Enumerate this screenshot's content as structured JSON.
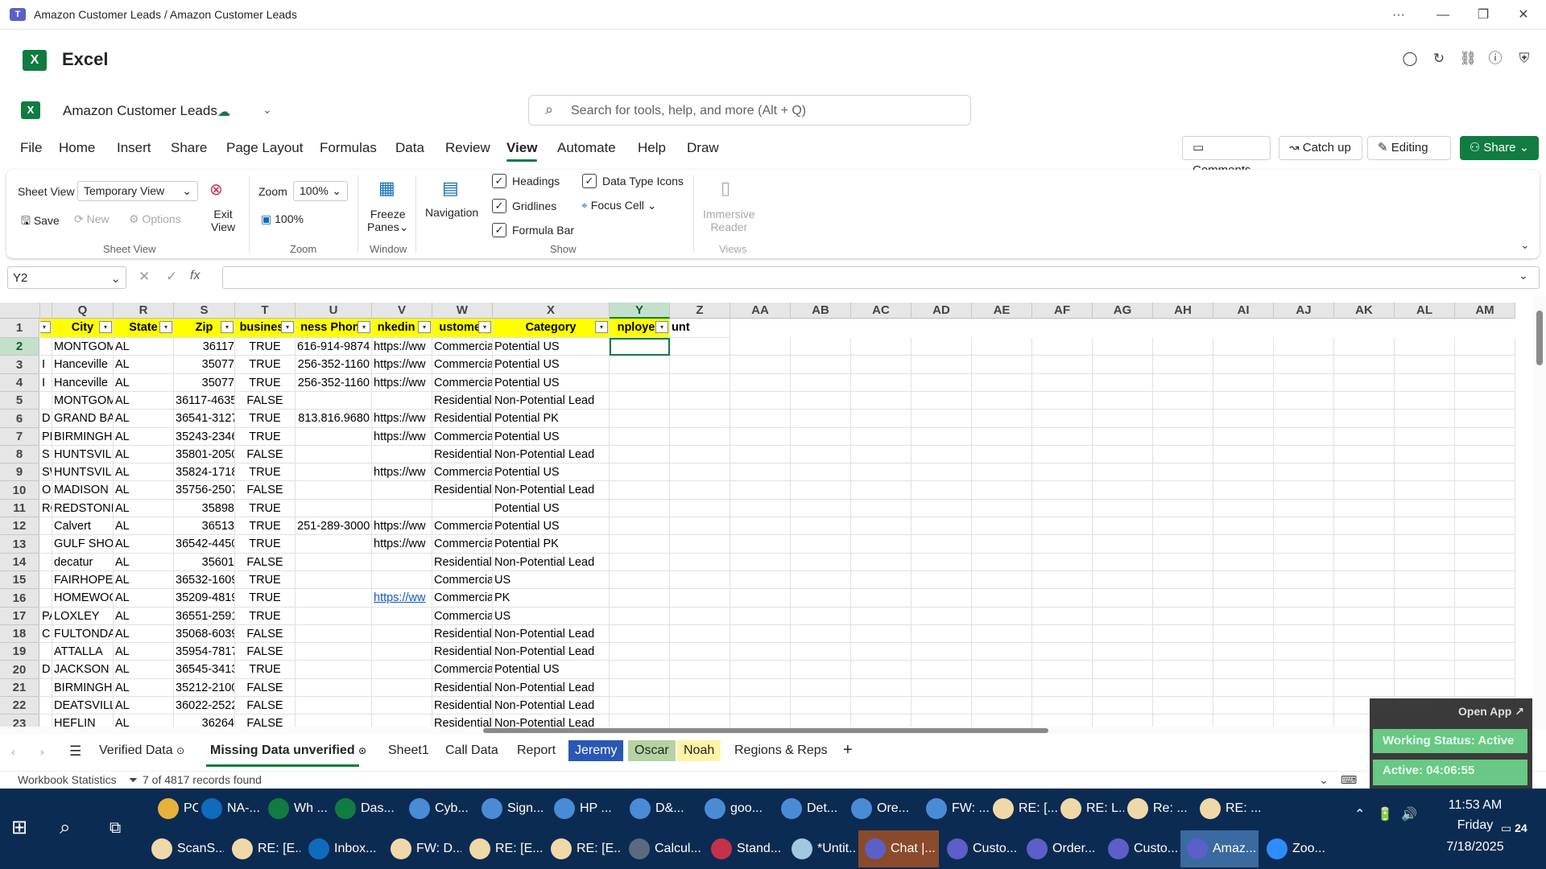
{
  "window": {
    "title": "Amazon Customer Leads / Amazon Customer Leads",
    "more": "···",
    "minimize": "—",
    "restore": "❐",
    "close": "✕"
  },
  "app": {
    "name": "Excel",
    "logo": "X"
  },
  "document": {
    "name": "Amazon Customer Leads",
    "save_status": "saved-cloud-icon"
  },
  "search": {
    "placeholder": "Search for tools, help, and more (Alt + Q)"
  },
  "menu": {
    "items": [
      "File",
      "Home",
      "Insert",
      "Share",
      "Page Layout",
      "Formulas",
      "Data",
      "Review",
      "View",
      "Automate",
      "Help",
      "Draw"
    ],
    "active": "View"
  },
  "buttons": {
    "comments": "Comments",
    "catch_up": "Catch up",
    "editing": "Editing",
    "share": "Share"
  },
  "ribbon": {
    "sheet_view": {
      "label": "Sheet View",
      "value": "Temporary View",
      "save": "Save",
      "new": "New",
      "options": "Options",
      "exit": "Exit",
      "exit2": "View",
      "group": "Sheet View"
    },
    "zoom": {
      "label": "Zoom",
      "value": "100%",
      "reset": "100%",
      "group": "Zoom"
    },
    "window": {
      "freeze": "Freeze",
      "panes": "Panes",
      "group": "Window"
    },
    "navigation": {
      "label": "Navigation"
    },
    "show": {
      "headings": "Headings",
      "gridlines": "Gridlines",
      "formula_bar": "Formula Bar",
      "data_type_icons": "Data Type Icons",
      "focus_cell": "Focus Cell",
      "group": "Show"
    },
    "views": {
      "immersive": "Immersive",
      "reader": "Reader",
      "group": "Views"
    }
  },
  "formula_bar": {
    "name_box": "Y2",
    "fx": "fx",
    "value": ""
  },
  "grid": {
    "columns": [
      "Q",
      "R",
      "S",
      "T",
      "U",
      "V",
      "W",
      "X",
      "Y",
      "Z",
      "AA",
      "AB",
      "AC",
      "AD",
      "AE",
      "AF",
      "AG",
      "AH",
      "AI",
      "AJ",
      "AK",
      "AL",
      "AM"
    ],
    "selected_column": "Y",
    "selected_row": "2",
    "header_row": [
      "City",
      "State",
      "Zip",
      "business",
      "ness Phone",
      "nkedin P",
      "ustomer",
      "Category",
      "nployee",
      "unt"
    ],
    "rows": [
      {
        "n": "2",
        "p": "",
        "q": "MONTGOM",
        "r": "AL",
        "s": "36117",
        "t": "TRUE",
        "u": "616-914-9874",
        "v": "https://ww",
        "w": "Commercia",
        "x": "Potential US"
      },
      {
        "n": "3",
        "p": "I",
        "q": "Hanceville",
        "r": "AL",
        "s": "35077",
        "t": "TRUE",
        "u": "256-352-1160",
        "v": "https://ww",
        "w": "Commercia",
        "x": "Potential US"
      },
      {
        "n": "4",
        "p": "I",
        "q": "Hanceville",
        "r": "AL",
        "s": "35077",
        "t": "TRUE",
        "u": "256-352-1160",
        "v": "https://ww",
        "w": "Commercia",
        "x": "Potential US"
      },
      {
        "n": "5",
        "p": "",
        "q": "MONTGOM",
        "r": "AL",
        "s": "36117-4635",
        "t": "FALSE",
        "u": "",
        "v": "",
        "w": "Residential",
        "x": "Non-Potential Lead"
      },
      {
        "n": "6",
        "p": "D",
        "q": "GRAND BA",
        "r": "AL",
        "s": "36541-3127",
        "t": "TRUE",
        "u": "813.816.9680",
        "v": "https://ww",
        "w": "Residential",
        "x": "Potential PK"
      },
      {
        "n": "7",
        "p": "PK",
        "q": "BIRMINGH",
        "r": "AL",
        "s": "35243-2346",
        "t": "TRUE",
        "u": "",
        "v": "https://ww",
        "w": "Commercia",
        "x": "Potential US"
      },
      {
        "n": "8",
        "p": "S",
        "q": "HUNTSVILL",
        "r": "AL",
        "s": "35801-2050",
        "t": "FALSE",
        "u": "",
        "v": "",
        "w": "Residential",
        "x": "Non-Potential Lead"
      },
      {
        "n": "9",
        "p": "SW",
        "q": "HUNTSVILL",
        "r": "AL",
        "s": "35824-1718",
        "t": "TRUE",
        "u": "",
        "v": "https://ww",
        "w": "Commercia",
        "x": "Potential US"
      },
      {
        "n": "10",
        "p": "OR",
        "q": "MADISON",
        "r": "AL",
        "s": "35756-2507",
        "t": "FALSE",
        "u": "",
        "v": "",
        "w": "Residential",
        "x": "Non-Potential Lead"
      },
      {
        "n": "11",
        "p": "RO",
        "q": "REDSTONI",
        "r": "AL",
        "s": "35898",
        "t": "TRUE",
        "u": "",
        "v": "",
        "w": "",
        "x": "Potential US"
      },
      {
        "n": "12",
        "p": "",
        "q": "Calvert",
        "r": "AL",
        "s": "36513",
        "t": "TRUE",
        "u": "251-289-3000",
        "v": "https://ww",
        "w": "Commercia",
        "x": "Potential US"
      },
      {
        "n": "13",
        "p": "",
        "q": "GULF SHO",
        "r": "AL",
        "s": "36542-4450",
        "t": "TRUE",
        "u": "",
        "v": "https://ww",
        "w": "Commercia",
        "x": "Potential PK"
      },
      {
        "n": "14",
        "p": "",
        "q": "decatur",
        "r": "AL",
        "s": "35601",
        "t": "FALSE",
        "u": "",
        "v": "",
        "w": "Residential",
        "x": "Non-Potential Lead"
      },
      {
        "n": "15",
        "p": "",
        "q": "FAIRHOPE",
        "r": "AL",
        "s": "36532-1609",
        "t": "TRUE",
        "u": "",
        "v": "",
        "w": "Commercia",
        "x": "US"
      },
      {
        "n": "16",
        "p": "",
        "q": "HOMEWOO",
        "r": "AL",
        "s": "35209-4819",
        "t": "TRUE",
        "u": "",
        "v": "https://ww",
        "w": "Commercia",
        "x": "PK",
        "link": true
      },
      {
        "n": "17",
        "p": "PA",
        "q": "LOXLEY",
        "r": "AL",
        "s": "36551-2591",
        "t": "TRUE",
        "u": "",
        "v": "",
        "w": "Commercia",
        "x": "US"
      },
      {
        "n": "18",
        "p": "C",
        "q": "FULTONDA",
        "r": "AL",
        "s": "35068-6039",
        "t": "FALSE",
        "u": "",
        "v": "",
        "w": "Residential",
        "x": "Non-Potential Lead"
      },
      {
        "n": "19",
        "p": "",
        "q": "ATTALLA",
        "r": "AL",
        "s": "35954-7817",
        "t": "FALSE",
        "u": "",
        "v": "",
        "w": "Residential",
        "x": "Non-Potential Lead"
      },
      {
        "n": "20",
        "p": "D",
        "q": "JACKSON",
        "r": "AL",
        "s": "36545-3413",
        "t": "TRUE",
        "u": "",
        "v": "",
        "w": "Commercia",
        "x": "Potential US"
      },
      {
        "n": "21",
        "p": "",
        "q": "BIRMINGH",
        "r": "AL",
        "s": "35212-2100",
        "t": "FALSE",
        "u": "",
        "v": "",
        "w": "Residential",
        "x": "Non-Potential Lead"
      },
      {
        "n": "22",
        "p": "",
        "q": "DEATSVILL",
        "r": "AL",
        "s": "36022-2522",
        "t": "FALSE",
        "u": "",
        "v": "",
        "w": "Residential",
        "x": "Non-Potential Lead"
      },
      {
        "n": "23",
        "p": "",
        "q": "HEFLIN",
        "r": "AL",
        "s": "36264",
        "t": "FALSE",
        "u": "",
        "v": "",
        "w": "Residential",
        "x": "Non-Potential Lead"
      }
    ]
  },
  "sheets": {
    "tabs": [
      "Verified Data",
      "Missing Data unverified",
      "Sheet1",
      "Call Data",
      "Report",
      "Jeremy",
      "Oscar",
      "Noah",
      "Regions & Reps"
    ],
    "active": "Missing Data unverified",
    "add": "+"
  },
  "status": {
    "workbook": "Workbook Statistics",
    "filter": "7 of 4817 records found"
  },
  "overlay": {
    "open_app": "Open App ↗",
    "working_status": "Working Status: Active",
    "active_time": "Active: 04:06:55",
    "zoom": "100%"
  },
  "taskbar": {
    "row1": [
      "PO ...",
      "NA-...",
      "Wh ...",
      "Das...",
      "Cyb...",
      "Sign...",
      "HP ...",
      "D&...",
      "goo...",
      "Det...",
      "Ore...",
      "FW: ...",
      "RE: [...",
      "RE: L...",
      "Re: ...",
      "RE: ..."
    ],
    "row2": [
      "ScanS...",
      "RE: [E...",
      "Inbox...",
      "FW: D...",
      "RE: [E...",
      "RE: [E...",
      "Calcul...",
      "Stand...",
      "*Untit...",
      "Chat |...",
      "Custo...",
      "Order...",
      "Custo...",
      "Amaz...",
      "Zoo..."
    ],
    "time": "11:53 AM",
    "day": "Friday",
    "date": "7/18/2025",
    "notif": "24"
  }
}
